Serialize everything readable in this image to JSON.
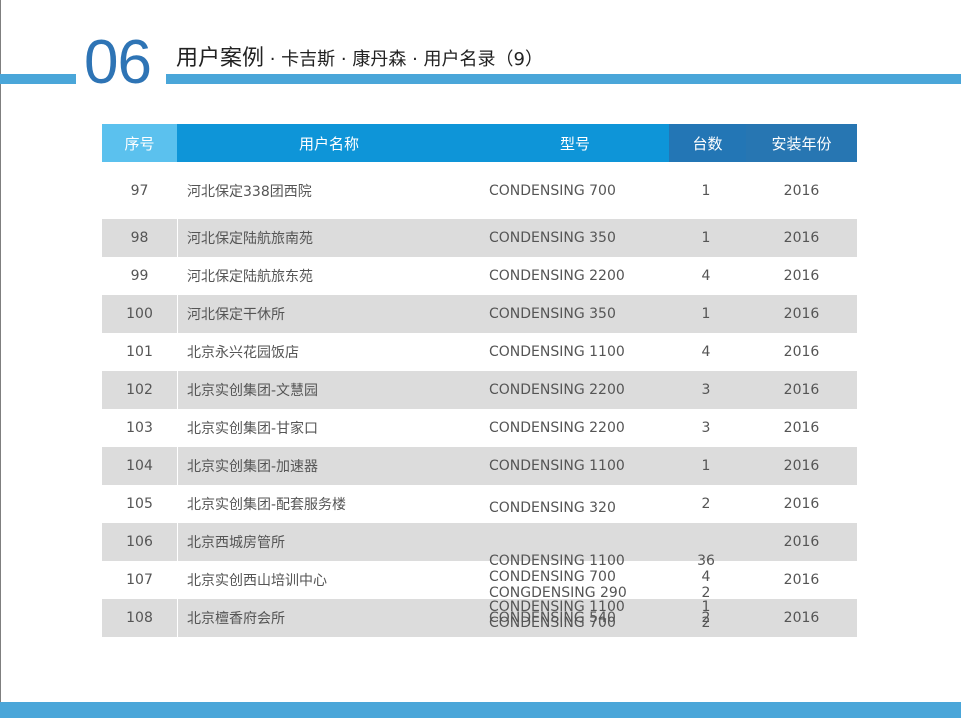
{
  "header": {
    "section_number": "06",
    "title_main": "用户案例",
    "title_sub": " · 卡吉斯 · 康丹森 · 用户名录（9）"
  },
  "table": {
    "columns": [
      "序号",
      "用户名称",
      "型号",
      "台数",
      "安装年份"
    ],
    "rows": [
      {
        "seq": "97",
        "name": "河北保定338团西院",
        "model": "CONDENSING 700",
        "qty": "1",
        "year": "2016"
      },
      {
        "seq": "98",
        "name": "河北保定陆航旅南苑",
        "model": "CONDENSING 350",
        "qty": "1",
        "year": "2016"
      },
      {
        "seq": "99",
        "name": "河北保定陆航旅东苑",
        "model": "CONDENSING 2200",
        "qty": "4",
        "year": "2016"
      },
      {
        "seq": "100",
        "name": "河北保定干休所",
        "model": "CONDENSING 350",
        "qty": "1",
        "year": "2016"
      },
      {
        "seq": "101",
        "name": "北京永兴花园饭店",
        "model": "CONDENSING 1100",
        "qty": "4",
        "year": "2016"
      },
      {
        "seq": "102",
        "name": "北京实创集团-文慧园",
        "model": "CONDENSING 2200",
        "qty": "3",
        "year": "2016"
      },
      {
        "seq": "103",
        "name": "北京实创集团-甘家口",
        "model": "CONDENSING 2200",
        "qty": "3",
        "year": "2016"
      },
      {
        "seq": "104",
        "name": "北京实创集团-加速器",
        "model": "CONDENSING 1100",
        "qty": "1",
        "year": "2016"
      },
      {
        "seq": "105",
        "name": "北京实创集团-配套服务楼",
        "model": "CONDENSING 320",
        "qty": "2",
        "year": "2016"
      },
      {
        "seq": "106",
        "name": "北京西城房管所",
        "model": "",
        "qty": "",
        "year": "2016"
      },
      {
        "seq": "107",
        "name": "北京实创西山培训中心",
        "model": "",
        "qty": "",
        "year": "2016"
      },
      {
        "seq": "108",
        "name": "北京檀香府会所",
        "model": "CONDENSING 540",
        "qty": "2",
        "year": "2016"
      }
    ],
    "overflow_models": [
      "CONDENSING 1100",
      "CONDENSING 700",
      "CONGDENSING 290",
      "CONDENSING 1100",
      "CONDENSING 700"
    ],
    "overflow_qtys": [
      "36",
      "4",
      "2",
      "1",
      "2"
    ]
  }
}
